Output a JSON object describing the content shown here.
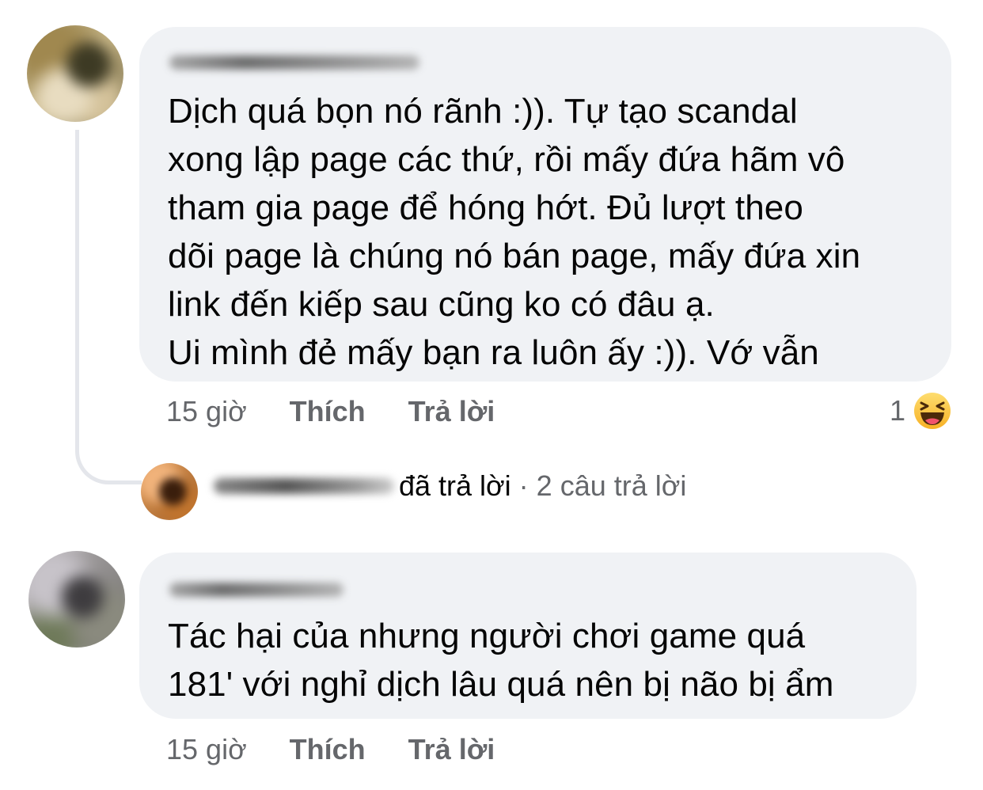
{
  "comments": [
    {
      "author": "",
      "text": "Dịch quá bọn nó rãnh :)). Tự tạo scandal\nxong lập page các thứ, rồi mấy đứa hãm vô\ntham gia page để hóng hớt. Đủ lượt theo\ndõi page là chúng nó bán page, mấy đứa xin\nlink đến kiếp sau cũng ko có đâu ạ.\nUi mình đẻ mấy bạn ra luôn ấy :)). Vớ vẫn",
      "time": "15 giờ",
      "like_label": "Thích",
      "reply_label": "Trả lời",
      "reaction": {
        "count": "1",
        "icon": "haha-emoji-icon",
        "color": "#f7b125"
      },
      "replies_summary": {
        "replied_text": "đã trả lời",
        "separator": "·",
        "count_text": "2 câu trả lời"
      }
    },
    {
      "author": "",
      "text": "Tác hại của nhưng người chơi game quá\n181' với nghỉ dịch lâu quá nên bị não bị ẩm",
      "time": "15 giờ",
      "like_label": "Thích",
      "reply_label": "Trả lời"
    }
  ],
  "colors": {
    "bubble_bg": "#f0f2f5",
    "text_primary": "#050505",
    "text_secondary": "#65676b",
    "thread_line": "#e4e6eb"
  }
}
